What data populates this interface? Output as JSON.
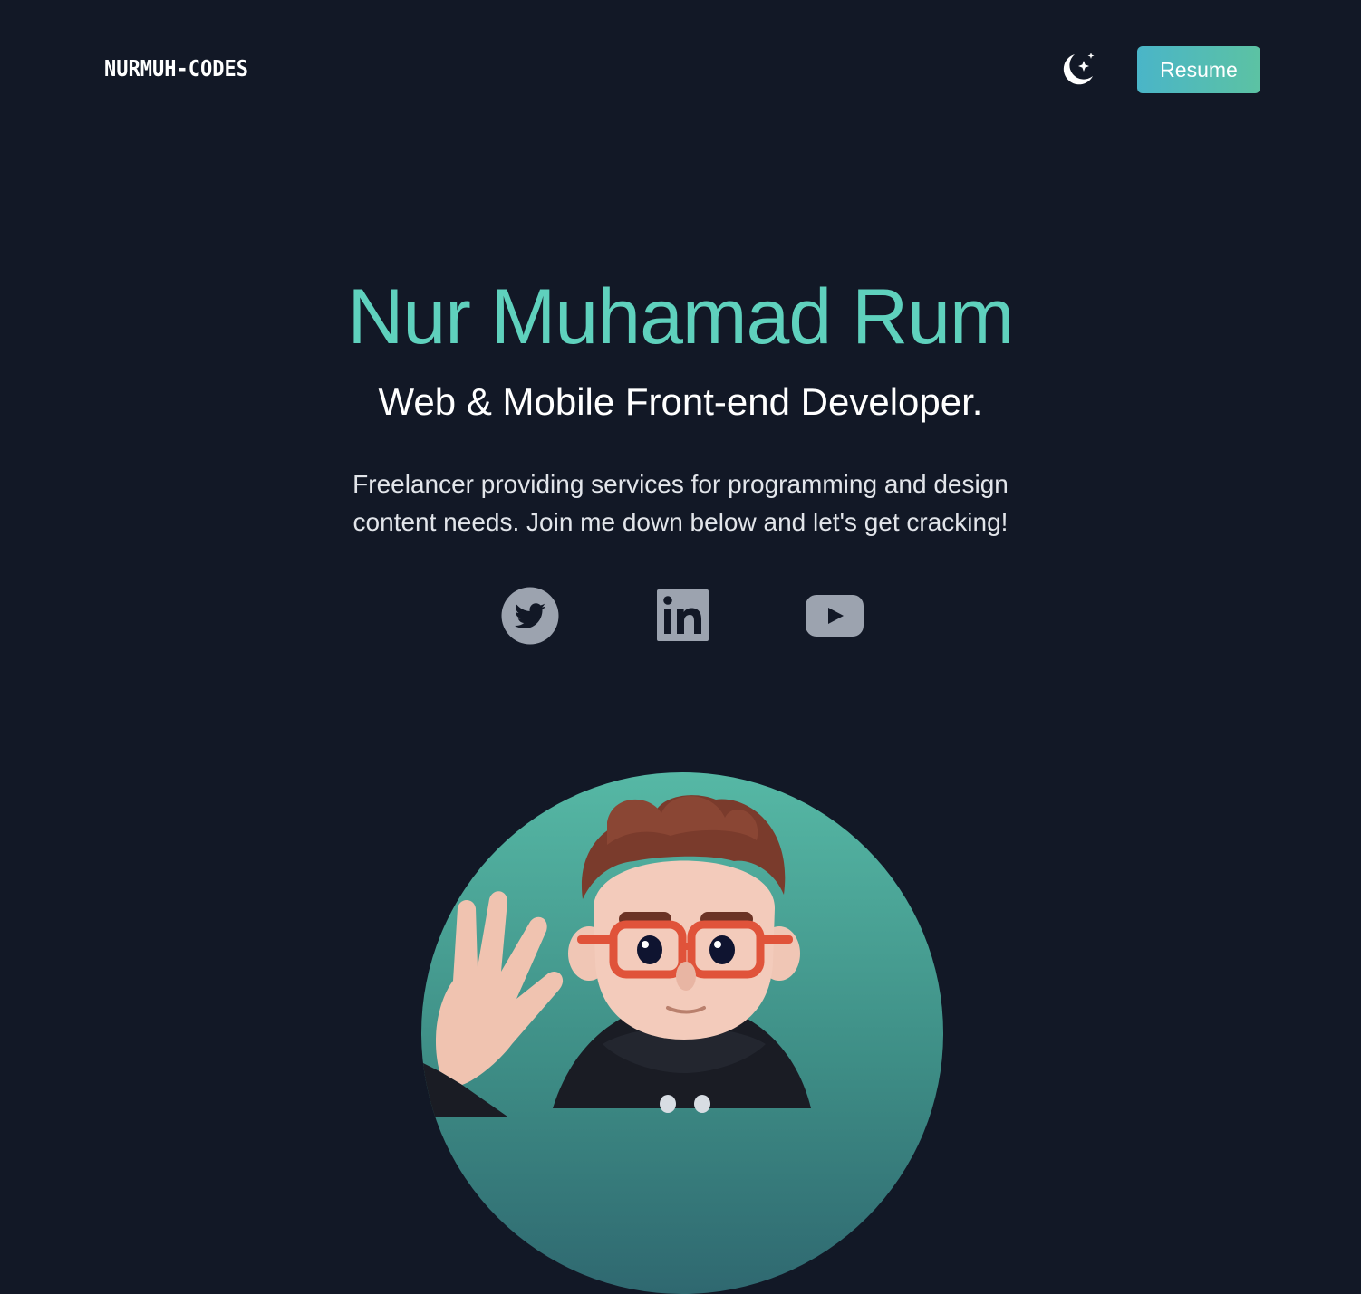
{
  "header": {
    "brand": "NURMUH-CODES",
    "theme_toggle_icon": "moon-stars-icon",
    "resume_label": "Resume"
  },
  "hero": {
    "name": "Nur Muhamad Rum",
    "role": "Web & Mobile Front-end Developer.",
    "description": "Freelancer providing services for programming and design content needs. Join me down below and let's get cracking!"
  },
  "social_links": [
    {
      "icon": "twitter-icon"
    },
    {
      "icon": "linkedin-icon"
    },
    {
      "icon": "youtube-icon"
    }
  ],
  "avatar": {
    "icon": "avatar-3d-character-illustration"
  },
  "colors": {
    "background": "#121826",
    "accent": "#5fd1bd",
    "resume_gradient_start": "#4ab5c8",
    "resume_gradient_end": "#5cc2a3",
    "social_icon": "#9ca3af"
  }
}
